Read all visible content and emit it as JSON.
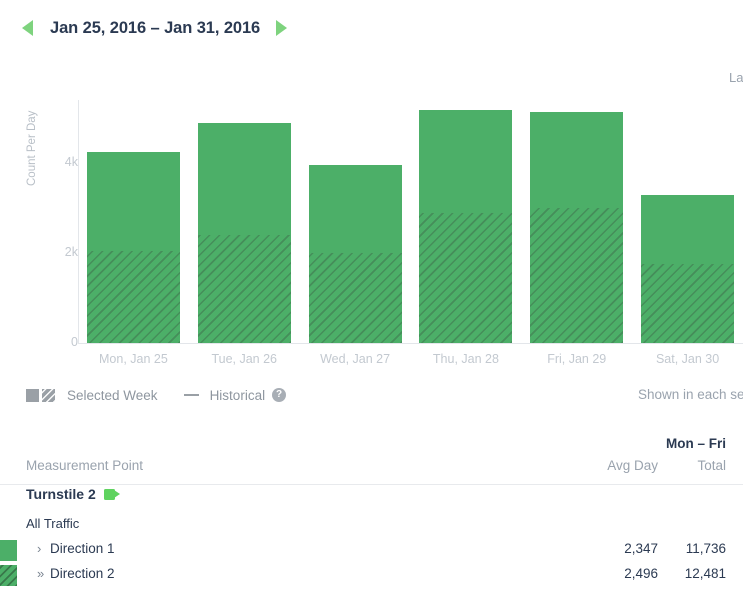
{
  "header": {
    "date_range": "Jan 25, 2016 – Jan 31, 2016",
    "prev_icon": "triangle-left-icon",
    "next_icon": "triangle-right-icon",
    "arrow_color": "#7ed37e"
  },
  "chart_corner": {
    "clipped_label": "La"
  },
  "legend": {
    "selected_week_label": "Selected Week",
    "historical_label": "Historical",
    "help_icon_glyph": "?",
    "note_clipped": "Shown in each ser",
    "swatch_color": "#9aa0a6"
  },
  "table": {
    "group_header": "Mon – Fri",
    "col_measurement": "Measurement Point",
    "col_avg_day": "Avg Day",
    "col_total": "Total",
    "measurement_point": "Turnstile 2",
    "camera_icon": "video-camera-icon",
    "section_label": "All Traffic",
    "rows": [
      {
        "chevron": "›",
        "label": "Direction 1",
        "avg_day": "2,347",
        "total": "11,736",
        "swatch": "solid"
      },
      {
        "chevron": "»",
        "label": "Direction 2",
        "avg_day": "2,496",
        "total": "12,481",
        "swatch": "hatched"
      }
    ]
  },
  "chart_data": {
    "type": "bar",
    "subtype": "stacked",
    "title": "",
    "xlabel": "",
    "ylabel": "Count Per Day",
    "ylim": [
      0,
      5400
    ],
    "yticks": [
      0,
      2000,
      4000
    ],
    "ytick_labels": [
      "0",
      "2k",
      "4k"
    ],
    "grid": false,
    "legend_position": "below",
    "bar_color": "#4caf68",
    "categories": [
      "Mon, Jan 25",
      "Tue, Jan 26",
      "Wed, Jan 27",
      "Thu, Jan 28",
      "Fri, Jan 29",
      "Sat, Jan 30"
    ],
    "series": [
      {
        "name": "Direction 2",
        "style": "hatched",
        "values": [
          2050,
          2400,
          2000,
          2900,
          3000,
          1760
        ]
      },
      {
        "name": "Direction 1",
        "style": "solid",
        "values": [
          2200,
          2490,
          1960,
          2280,
          2140,
          1520
        ]
      }
    ],
    "totals": [
      4250,
      4890,
      3960,
      5180,
      5140,
      3280
    ],
    "last_category_clipped": true
  }
}
